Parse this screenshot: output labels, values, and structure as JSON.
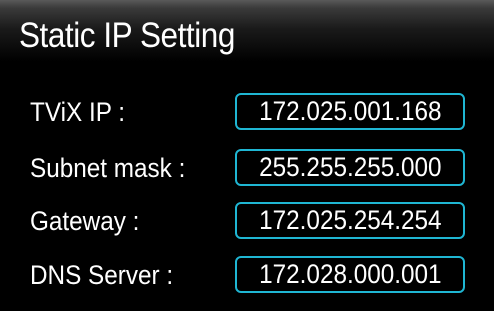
{
  "dialog": {
    "title": "Static IP Setting"
  },
  "fields": [
    {
      "label": "TViX IP :",
      "value": "172.025.001.168"
    },
    {
      "label": "Subnet mask :",
      "value": "255.255.255.000"
    },
    {
      "label": "Gateway :",
      "value": "172.025.254.254"
    },
    {
      "label": "DNS Server :",
      "value": "172.028.000.001"
    }
  ],
  "colors": {
    "background": "#000000",
    "text": "#ffffff",
    "field_border": "#1fb6d3"
  }
}
